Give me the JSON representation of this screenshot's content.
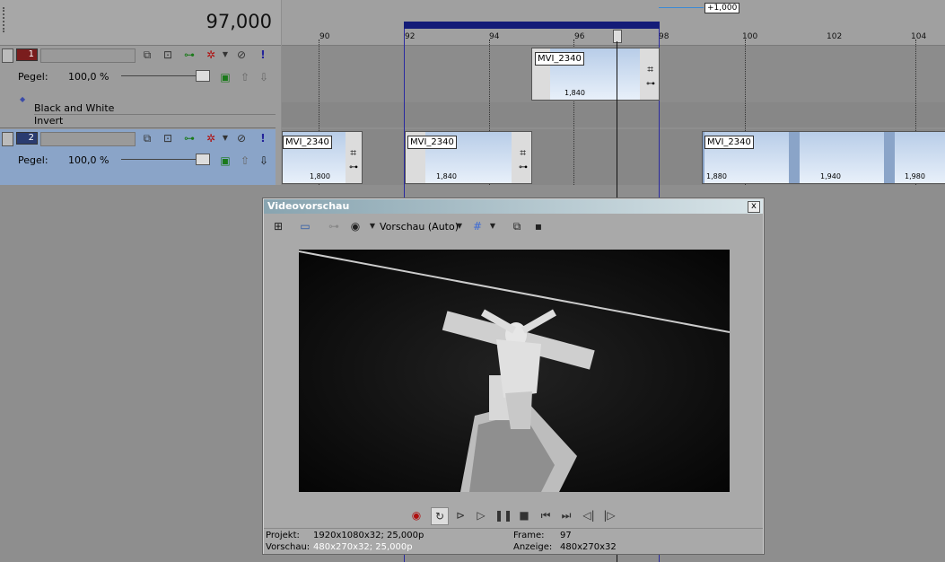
{
  "time_display": "97,000",
  "offset_tag": "+1,000",
  "ruler": {
    "labels": [
      "90",
      "92",
      "94",
      "96",
      "98",
      "100",
      "102",
      "104"
    ]
  },
  "tracks": [
    {
      "number": "1",
      "level_label": "Pegel:",
      "level_value": "100,0 %",
      "level": 0.92,
      "color": "#7a1d1d",
      "effects": [
        "Black and White",
        "Invert"
      ]
    },
    {
      "number": "2",
      "level_label": "Pegel:",
      "level_value": "100,0 %",
      "level": 0.92,
      "color": "#2a3c70"
    }
  ],
  "clips": {
    "track1": [
      {
        "name": "MVI_2340",
        "value": "1,840"
      }
    ],
    "track2": [
      {
        "name": "MVI_2340",
        "value": "1,800"
      },
      {
        "name": "MVI_2340",
        "value": "1,840"
      },
      {
        "name": "MVI_2340",
        "value": "1,880"
      },
      {
        "value": "1,940"
      },
      {
        "value": "1,980"
      }
    ]
  },
  "preview": {
    "title": "Videovorschau",
    "close": "x",
    "mode": "Vorschau (Auto)",
    "status": {
      "projekt_label": "Projekt:",
      "projekt_value": "1920x1080x32; 25,000p",
      "vorschau_label": "Vorschau:",
      "vorschau_value": "480x270x32; 25,000p",
      "frame_label": "Frame:",
      "frame_value": "97",
      "anzeige_label": "Anzeige:",
      "anzeige_value": "480x270x32"
    }
  },
  "icons": {
    "collapse": "track-collapse-icon",
    "record": "record-icon",
    "loop": "loop-icon",
    "play-start": "play-from-start-icon",
    "play": "play-icon",
    "pause": "pause-icon",
    "stop": "stop-icon",
    "prev": "previous-frame-icon",
    "next": "next-frame-icon"
  }
}
